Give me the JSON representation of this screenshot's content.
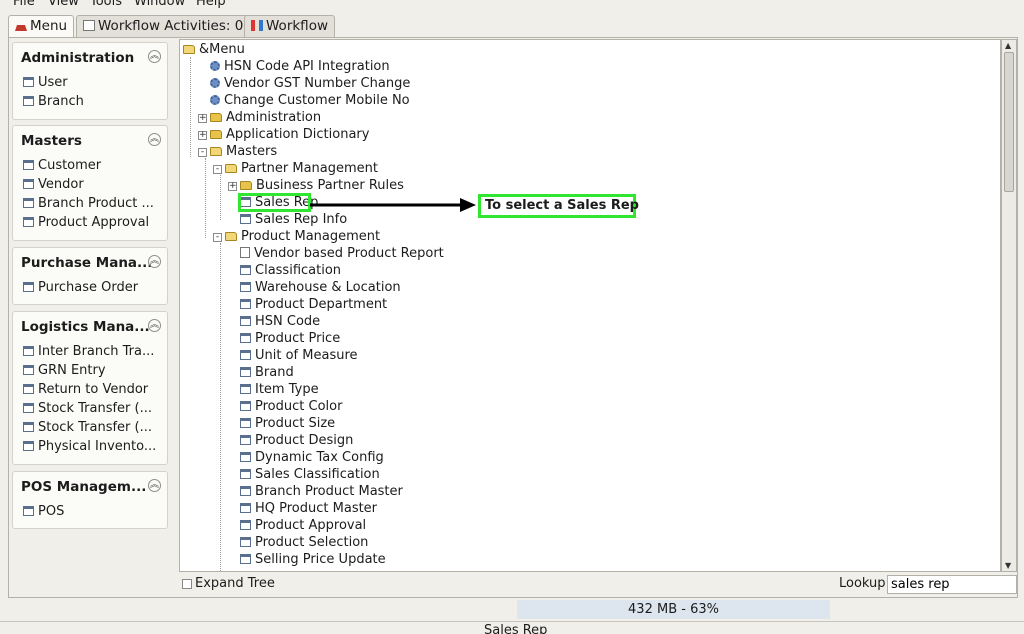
{
  "menubar": [
    "File",
    "View",
    "Tools",
    "Window",
    "Help"
  ],
  "tabs": [
    {
      "label": "Menu",
      "icon": "home-icon"
    },
    {
      "label": "Workflow Activities: 0",
      "icon": "document-icon"
    },
    {
      "label": "Workflow",
      "icon": "workflow-icon"
    }
  ],
  "sidebar": [
    {
      "title": "Administration",
      "items": [
        "User",
        "Branch"
      ]
    },
    {
      "title": "Masters",
      "items": [
        "Customer",
        "Vendor",
        "Branch Product ...",
        "Product Approval"
      ]
    },
    {
      "title": "Purchase Mana...",
      "items": [
        "Purchase Order"
      ]
    },
    {
      "title": "Logistics Mana...",
      "items": [
        "Inter Branch Tra...",
        "GRN Entry",
        "Return to Vendor",
        "Stock Transfer (...",
        "Stock Transfer (...",
        "Physical Invento..."
      ]
    },
    {
      "title": "POS Managem...",
      "items": [
        "POS"
      ]
    }
  ],
  "tree": [
    {
      "label": "&Menu",
      "icon": "folder-open",
      "level": 0
    },
    {
      "label": "HSN Code API Integration",
      "icon": "process",
      "level": 1
    },
    {
      "label": "Vendor GST Number Change",
      "icon": "process",
      "level": 1
    },
    {
      "label": "Change Customer Mobile No",
      "icon": "process",
      "level": 1
    },
    {
      "label": "Administration",
      "icon": "folder",
      "level": 1,
      "toggle": "+"
    },
    {
      "label": "Application Dictionary",
      "icon": "folder",
      "level": 1,
      "toggle": "+"
    },
    {
      "label": "Masters",
      "icon": "folder-open",
      "level": 1,
      "toggle": "-"
    },
    {
      "label": "Partner Management",
      "icon": "folder-open",
      "level": 2,
      "toggle": "-"
    },
    {
      "label": "Business Partner Rules",
      "icon": "folder",
      "level": 3,
      "toggle": "+"
    },
    {
      "label": "Sales Rep",
      "icon": "window",
      "level": 3,
      "selected": true
    },
    {
      "label": "Sales Rep Info",
      "icon": "window",
      "level": 3
    },
    {
      "label": "Product Management",
      "icon": "folder-open",
      "level": 2,
      "toggle": "-"
    },
    {
      "label": "Vendor based Product Report",
      "icon": "report",
      "level": 3
    },
    {
      "label": "Classification",
      "icon": "window",
      "level": 3
    },
    {
      "label": "Warehouse & Location",
      "icon": "window",
      "level": 3
    },
    {
      "label": "Product Department",
      "icon": "window",
      "level": 3
    },
    {
      "label": "HSN Code",
      "icon": "window",
      "level": 3
    },
    {
      "label": "Product Price",
      "icon": "window",
      "level": 3
    },
    {
      "label": "Unit of Measure",
      "icon": "window",
      "level": 3
    },
    {
      "label": "Brand",
      "icon": "window",
      "level": 3
    },
    {
      "label": "Item Type",
      "icon": "window",
      "level": 3
    },
    {
      "label": "Product Color",
      "icon": "window",
      "level": 3
    },
    {
      "label": "Product Size",
      "icon": "window",
      "level": 3
    },
    {
      "label": "Product Design",
      "icon": "window",
      "level": 3
    },
    {
      "label": "Dynamic Tax Config",
      "icon": "window",
      "level": 3
    },
    {
      "label": "Sales Classification",
      "icon": "window",
      "level": 3
    },
    {
      "label": "Branch Product Master",
      "icon": "window",
      "level": 3
    },
    {
      "label": "HQ Product Master",
      "icon": "window",
      "level": 3
    },
    {
      "label": "Product Approval",
      "icon": "window",
      "level": 3
    },
    {
      "label": "Product Selection",
      "icon": "window",
      "level": 3
    },
    {
      "label": "Selling Price Update",
      "icon": "window",
      "level": 3
    }
  ],
  "bottom": {
    "expand_tree_label": "Expand Tree",
    "lookup_label": "Lookup",
    "lookup_value": "sales rep"
  },
  "memory": "432 MB - 63%",
  "status_text": "Sales Rep",
  "annotation": {
    "text": "To select a Sales Rep",
    "color": "#30e630"
  }
}
